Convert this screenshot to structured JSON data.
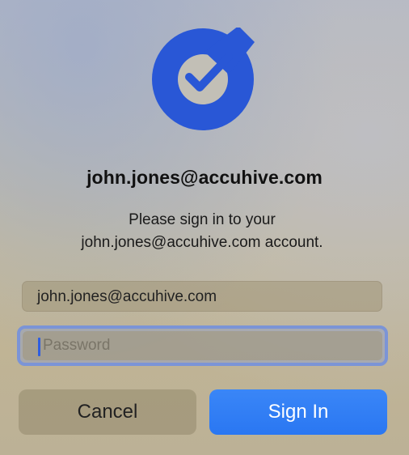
{
  "dialog": {
    "account_title": "john.jones@accuhive.com",
    "message_line1": "Please sign in to your",
    "message_line2": "john.jones@accuhive.com account.",
    "email_value": "john.jones@accuhive.com",
    "password_placeholder": "Password",
    "cancel_label": "Cancel",
    "signin_label": "Sign In"
  },
  "icons": {
    "logo": "checkmark-circle-logo-icon"
  },
  "colors": {
    "logo_blue": "#2957d6",
    "primary_button": "#2f7ff5",
    "focus_ring": "#7b94d6"
  }
}
